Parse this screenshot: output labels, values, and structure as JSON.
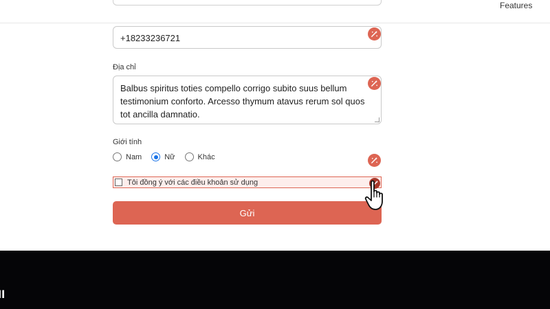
{
  "nav": {
    "features_label": "Features"
  },
  "form": {
    "phone": {
      "value": "+18233236721"
    },
    "address": {
      "label": "Địa chỉ",
      "value": "Balbus spiritus toties compello corrigo subito suus bellum testimonium conforto. Arcesso thymum atavus rerum sol quos tot ancilla damnatio."
    },
    "gender": {
      "label": "Giới tính",
      "options": [
        {
          "label": "Nam",
          "checked": false
        },
        {
          "label": "Nữ",
          "checked": true
        },
        {
          "label": "Khác",
          "checked": false
        }
      ]
    },
    "consent": {
      "label": "Tôi đồng ý với các điều khoản sử dụng",
      "checked": false
    },
    "submit_label": "Gửi"
  },
  "footer": {
    "logo_text": "ll"
  },
  "icons": {
    "field_action": "magic-wand-icon",
    "cursor": "hand-pointer-icon"
  },
  "colors": {
    "accent": "#dd6553",
    "accent_dark": "#a8392c",
    "radio_selected": "#1a73e8",
    "footer_bg": "#050507"
  }
}
